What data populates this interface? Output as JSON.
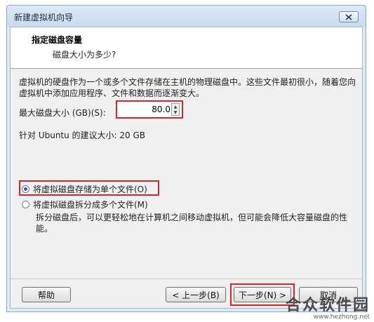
{
  "window": {
    "title": "新建虚拟机向导"
  },
  "header": {
    "title": "指定磁盘容量",
    "subtitle": "磁盘大小为多少?"
  },
  "description": "虚拟机的硬盘作为一个或多个文件存储在主机的物理磁盘中。这些文件最初很小，随着您向虚拟机中添加应用程序、文件和数据而逐渐变大。",
  "disk_size": {
    "label": "最大磁盘大小 (GB)(S):",
    "value": "80.0"
  },
  "recommended": "针对 Ubuntu 的建议大小: 20 GB",
  "options": [
    {
      "label": "将虚拟磁盘存储为单个文件(O)",
      "selected": true
    },
    {
      "label": "将虚拟磁盘拆分成多个文件(M)",
      "selected": false
    }
  ],
  "split_description": "拆分磁盘后，可以更轻松地在计算机之间移动虚拟机，但可能会降低大容量磁盘的性能。",
  "buttons": {
    "help": "帮助",
    "back": "< 上一步(B)",
    "next": "下一步(N) >",
    "cancel": "取消"
  },
  "watermark": {
    "name": "合众软件园",
    "url": "www.hezhong.net"
  }
}
